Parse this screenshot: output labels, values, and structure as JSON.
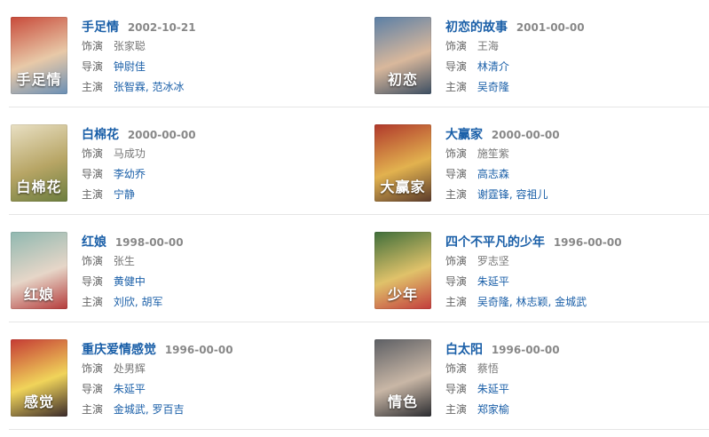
{
  "labels": {
    "dubber": "饰演",
    "director": "导演",
    "star": "主演"
  },
  "movies": [
    {
      "title": "手足情",
      "date": "2002-10-21",
      "dubber": "张家聪",
      "director": "钟尉佳",
      "stars": [
        "张智霖",
        "范冰冰"
      ],
      "poster_text": "手足情",
      "colors": [
        "#c84a3a",
        "#e8c9a8",
        "#6a8fb5"
      ]
    },
    {
      "title": "初恋的故事",
      "date": "2001-00-00",
      "dubber": "王海",
      "director": "林清介",
      "stars": [
        "吴奇隆"
      ],
      "poster_text": "初恋",
      "colors": [
        "#5b7fa6",
        "#d9b89c",
        "#3c4e62"
      ]
    },
    {
      "title": "白棉花",
      "date": "2000-00-00",
      "dubber": "马成功",
      "director": "李幼乔",
      "stars": [
        "宁静"
      ],
      "poster_text": "白棉花",
      "colors": [
        "#e9e0c4",
        "#b7a565",
        "#6b7d3e"
      ]
    },
    {
      "title": "大赢家",
      "date": "2000-00-00",
      "dubber": "施笙紫",
      "director": "高志森",
      "stars": [
        "谢霆锋",
        "容祖儿"
      ],
      "poster_text": "大赢家",
      "colors": [
        "#b0382b",
        "#e2b24f",
        "#5a3a2a"
      ]
    },
    {
      "title": "红娘",
      "date": "1998-00-00",
      "dubber": "张生",
      "director": "黄健中",
      "stars": [
        "刘欣",
        "胡军"
      ],
      "poster_text": "红娘",
      "colors": [
        "#8fb8b0",
        "#e6d6c8",
        "#b43a3a"
      ]
    },
    {
      "title": "四个不平凡的少年",
      "date": "1996-00-00",
      "dubber": "罗志坚",
      "director": "朱延平",
      "stars": [
        "吴奇隆",
        "林志颖",
        "金城武"
      ],
      "poster_text": "少年",
      "colors": [
        "#3f6e3a",
        "#e0c26a",
        "#c23c3c"
      ]
    },
    {
      "title": "重庆爱情感觉",
      "date": "1996-00-00",
      "dubber": "处男辉",
      "director": "朱延平",
      "stars": [
        "金城武",
        "罗百吉"
      ],
      "poster_text": "感觉",
      "colors": [
        "#c53a34",
        "#f0d45a",
        "#3a2a2a"
      ]
    },
    {
      "title": "白太阳",
      "date": "1996-00-00",
      "dubber": "蔡悟",
      "director": "朱延平",
      "stars": [
        "郑家榆"
      ],
      "poster_text": "情色",
      "colors": [
        "#5d5f64",
        "#c9b7a6",
        "#2b2c30"
      ]
    }
  ]
}
